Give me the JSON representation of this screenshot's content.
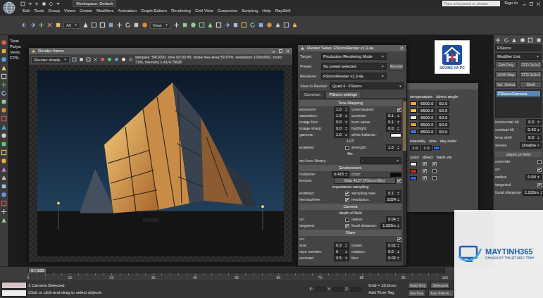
{
  "app": {
    "title": "Workspace: Default",
    "search_placeholder": "Type a keyword or phrase",
    "sign_in": "Sign In"
  },
  "menu": [
    "Edit",
    "Tools",
    "Group",
    "Views",
    "Create",
    "Modifiers",
    "Animation",
    "Graph Editors",
    "Rendering",
    "Civil View",
    "Customize",
    "Scripting",
    "Help",
    "RaySkill"
  ],
  "toolbar": {
    "filter": "All",
    "view": "View"
  },
  "viewport": {
    "stats": [
      "Total",
      "Polys:",
      "Verts:",
      "FPS:"
    ]
  },
  "render_frame": {
    "title": "Render frame",
    "area": "Render shade",
    "stats": "samples: 54/1000, time 00:00:45, noise free area 59.67%, resolution 1000x900, zoom 71%, memory 1.41/4.79GB"
  },
  "render_setup": {
    "title": "Render Setup: FStormRender v1.3.4a",
    "fields": [
      {
        "label": "Target:",
        "value": "Production Rendering Mode"
      },
      {
        "label": "Preset:",
        "value": "No preset selected"
      },
      {
        "label": "Renderer:",
        "value": "FStormRender v1.3.4a"
      }
    ],
    "view_field": {
      "label": "View to Render:",
      "value": "Quad 4 - FStorm"
    },
    "render_button": "Render",
    "tabs": [
      {
        "label": "Common",
        "selected": false
      },
      {
        "label": "FStorm settings",
        "selected": true
      }
    ],
    "sections": [
      {
        "title": "Tone Mapping",
        "rows": [
          [
            {
              "kind": "num",
              "label": "exposure:",
              "value": "1.0"
            },
            {
              "kind": "check",
              "label": "tonemapped:",
              "checked": true
            }
          ],
          [
            {
              "kind": "num",
              "label": "saturation:",
              "value": "1.0"
            },
            {
              "kind": "num",
              "label": "contrast:",
              "value": "0.1"
            }
          ],
          [
            {
              "kind": "num",
              "label": "image blur:",
              "value": "0.0"
            },
            {
              "kind": "num",
              "label": "burn value:",
              "value": "0.1"
            }
          ],
          [
            {
              "kind": "num",
              "label": "image sharp:",
              "value": "0.0"
            },
            {
              "kind": "num",
              "label": "highlight:",
              "value": "0.0"
            }
          ],
          [
            {
              "kind": "num",
              "label": "gamma:",
              "value": "1.0"
            },
            {
              "kind": "color",
              "label": "white balance:",
              "color": "#ffffff"
            }
          ],
          [
            {
              "kind": "label",
              "label": "LUT"
            }
          ],
          [
            {
              "kind": "check",
              "label": "enabled:",
              "checked": false
            },
            {
              "kind": "num",
              "label": "strength:",
              "value": "1.0"
            }
          ],
          [
            {
              "kind": "label",
              "label": "file:"
            }
          ],
          [
            {
              "kind": "select",
              "label": "set from library:",
              "value": "-"
            }
          ]
        ]
      },
      {
        "title": "Environment",
        "rows": [
          [
            {
              "kind": "num",
              "label": "multiplier:",
              "value": "0.415"
            },
            {
              "kind": "color",
              "label": "color:",
              "color": "#0a0a0a"
            }
          ],
          [
            {
              "kind": "map",
              "label": "texture:",
              "value": "Map #127 (FStormSky)",
              "checked": true
            }
          ],
          [
            {
              "kind": "label",
              "label": "importance sampling"
            }
          ],
          [
            {
              "kind": "check",
              "label": "enabled:",
              "checked": true
            },
            {
              "kind": "num",
              "label": "sampling rate:",
              "value": "0.1"
            }
          ],
          [
            {
              "kind": "check",
              "label": "hemisphere:",
              "checked": true
            },
            {
              "kind": "num",
              "label": "resolution:",
              "value": "1024"
            }
          ]
        ]
      },
      {
        "title": "Camera",
        "rows": [
          [
            {
              "kind": "label",
              "label": "depth of field"
            }
          ],
          [
            {
              "kind": "check",
              "label": "on:",
              "checked": false
            },
            {
              "kind": "num",
              "label": "radius:",
              "value": "0.04"
            }
          ],
          [
            {
              "kind": "check",
              "label": "targeted:",
              "checked": true
            },
            {
              "kind": "num",
              "label": "focal distance:",
              "value": "1.020m"
            }
          ]
        ]
      },
      {
        "title": "Glare",
        "rows": [
          [
            {
              "kind": "check",
              "label": "on:",
              "checked": true
            }
          ],
          [
            {
              "kind": "num",
              "label": "size:",
              "value": "0.3"
            },
            {
              "kind": "num",
              "label": "power:",
              "value": "0.01"
            }
          ],
          [
            {
              "kind": "num",
              "label": "rays number:",
              "value": "6"
            },
            {
              "kind": "num",
              "label": "rotation:",
              "value": "0.0"
            }
          ],
          [
            {
              "kind": "num",
              "label": "contrast:",
              "value": "0.5"
            },
            {
              "kind": "num",
              "label": "blur:",
              "value": "0.03"
            }
          ]
        ]
      }
    ]
  },
  "light_lister": {
    "headers": [
      "temperature",
      "direct angle"
    ],
    "lights": [
      {
        "color": "#f2a93b",
        "temperature": "6500.0",
        "angle": "60.0"
      },
      {
        "color": "#f5c04a",
        "temperature": "6500.0",
        "angle": "60.0"
      },
      {
        "color": "#e9e9e9",
        "temperature": "6500.0",
        "angle": "60.0"
      },
      {
        "color": "#ef9f35",
        "temperature": "6500.0",
        "angle": "60.0"
      },
      {
        "color": "#3a7bd5",
        "temperature": "6500.0",
        "angle": "60.0"
      }
    ],
    "sky": {
      "headers": [
        "intensity",
        "size",
        "sky color"
      ],
      "intensity": "1.0",
      "size": "1.0",
      "color": "#2f6fdc"
    },
    "visibility": {
      "headers": [
        "color",
        "direct",
        "back vis"
      ],
      "rows": [
        {
          "color": "#e8e8e8",
          "direct": true,
          "back": true
        },
        {
          "color": "#d42020",
          "direct": true,
          "back": false
        },
        {
          "color": "#2d62d6",
          "direct": true,
          "back": false
        }
      ]
    }
  },
  "logo": {
    "text": "HOÀNG HÀ PC"
  },
  "watermark": {
    "brand": "MAYTINH365",
    "tagline": "CHUẨN KỸ THUẬT MÁY TÍNH"
  },
  "command_panel": {
    "object_name": "FStorm",
    "modifier_list": "Modifier List",
    "modifiers": [
      "Edit Poly",
      "FFD 2x2x2",
      "UVW Map",
      "FFD 3x3x3",
      "Vol. Select",
      "Shell"
    ],
    "stack": [
      {
        "label": "FStormCamera",
        "selected": true
      }
    ],
    "params": [
      {
        "kind": "num",
        "label": "horizontal tilt",
        "value": "0.0"
      },
      {
        "kind": "num",
        "label": "vertical tilt",
        "value": "0.42"
      },
      {
        "kind": "num",
        "label": "lens shift",
        "value": "0.0"
      },
      {
        "kind": "select",
        "label": "stereo",
        "value": "Disable"
      },
      {
        "kind": "header",
        "label": "depth of field"
      },
      {
        "kind": "check",
        "label": "override",
        "checked": false
      },
      {
        "kind": "check",
        "label": "on",
        "checked": true
      },
      {
        "kind": "num",
        "label": "radius",
        "value": "0.04"
      },
      {
        "kind": "check",
        "label": "targeted",
        "checked": true
      },
      {
        "kind": "num",
        "label": "focal distance",
        "value": "1.020m"
      }
    ]
  },
  "timeline": {
    "frame": "0 / 100",
    "ticks": [
      "0",
      "10",
      "20",
      "30",
      "40",
      "50",
      "60",
      "70",
      "80",
      "90",
      "100"
    ]
  },
  "status": {
    "selection": "1 Camera Selected",
    "prompt": "Click or click-and-drag to select objects",
    "coords": [
      "X:",
      "Y:",
      "Z:"
    ],
    "grid": "Grid = 10.0mm",
    "time_tag": "Add Time Tag",
    "auto_key": "Auto Key",
    "key_mode": "Selected",
    "set_key": "Set Key",
    "key_filters": "Key Filters..."
  }
}
